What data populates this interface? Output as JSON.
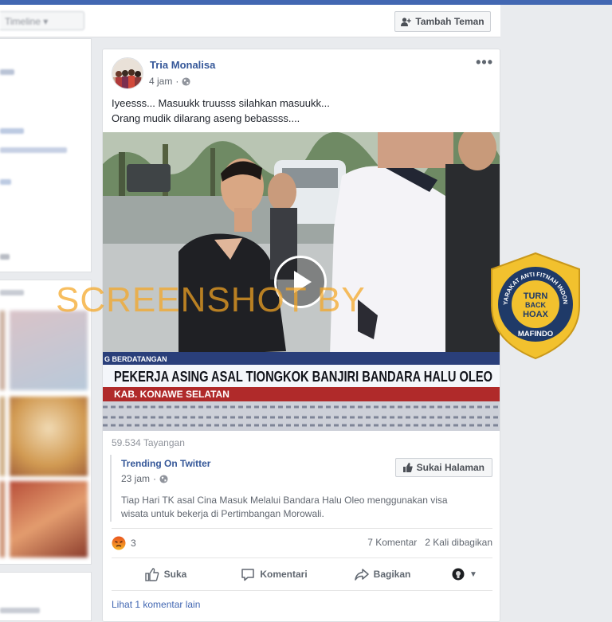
{
  "profile_bar": {
    "tab_label": "Timeline",
    "add_friend_label": "Tambah Teman"
  },
  "post": {
    "author": "Tria Monalisa",
    "time": "4 jam",
    "text_line1": "Iyeesss... Masuukk truusss silahkan masuukk...",
    "text_line2": "Orang mudik dilarang aseng bebassss....",
    "video": {
      "ticker_label": "G BERDATANGAN",
      "headline": "PEKERJA ASING ASAL TIONGKOK BANJIRI BANDARA HALU OLEO",
      "location": "KAB. KONAWE SELATAN"
    },
    "views": "59.534 Tayangan",
    "shared": {
      "page_name": "Trending On Twitter",
      "time": "23 jam",
      "like_page_label": "Sukai Halaman",
      "text": "Tiap Hari TK asal Cina Masuk Melalui Bandara Halu Oleo menggunakan visa wisata untuk bekerja di Pertimbangan Morowali."
    },
    "reaction_count": "3",
    "comments_count": "7 Komentar",
    "shares_count": "2 Kali dibagikan",
    "actions": {
      "like": "Suka",
      "comment": "Komentari",
      "share": "Bagikan"
    },
    "more_comments": "Lihat 1 komentar lain"
  },
  "overlay": {
    "watermark": "SCREENSHOT BY",
    "badge_line1": "TURN",
    "badge_line2": "BACK",
    "badge_line3": "HOAX",
    "badge_ring_text": "MASYARAKAT ANTI FITNAH INDONESIA",
    "badge_org": "MAFINDO"
  },
  "colors": {
    "brand_blue": "#4267b2",
    "link_blue": "#365899",
    "watermark_orange": "#f5a623",
    "badge_gold": "#f2c12e",
    "badge_navy": "#1f3a68"
  }
}
